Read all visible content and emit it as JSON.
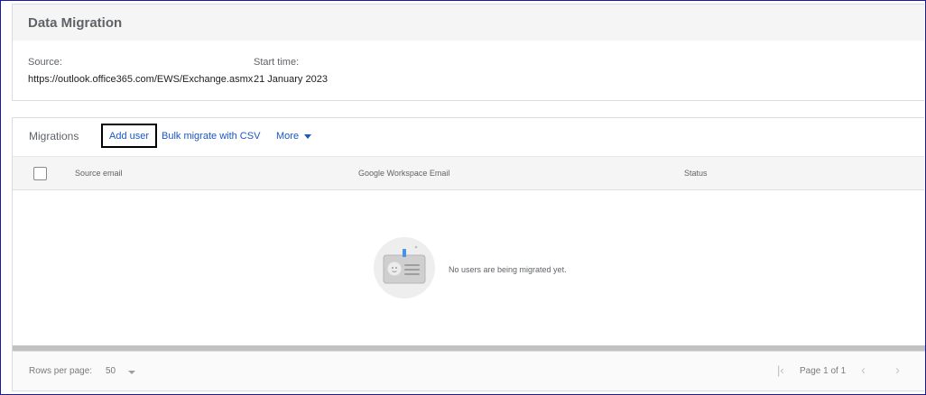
{
  "page": {
    "title": "Data Migration",
    "source_label": "Source:",
    "source_value": "https://outlook.office365.com/EWS/Exchange.asmx",
    "start_time_label": "Start time:",
    "start_time_value": "21 January 2023"
  },
  "migrations": {
    "title": "Migrations",
    "add_user": "Add user",
    "bulk_migrate": "Bulk migrate with CSV",
    "more": "More",
    "columns": [
      "Source email",
      "Google Workspace Email",
      "Status"
    ],
    "empty_message": "No users are being migrated yet."
  },
  "footer": {
    "rows_per_page_label": "Rows per page:",
    "rows_per_page_value": "50",
    "page_text": "Page 1 of 1"
  },
  "icons": {
    "more_caret": "caret-down",
    "empty_state": "user-card",
    "rows_caret": "caret-down",
    "first_page": "first-page",
    "prev_page": "chevron-left",
    "next_page": "chevron-right"
  },
  "colors": {
    "link": "#1a57c4",
    "frame": "#1a1aa8",
    "header_bg": "#f5f5f5"
  }
}
